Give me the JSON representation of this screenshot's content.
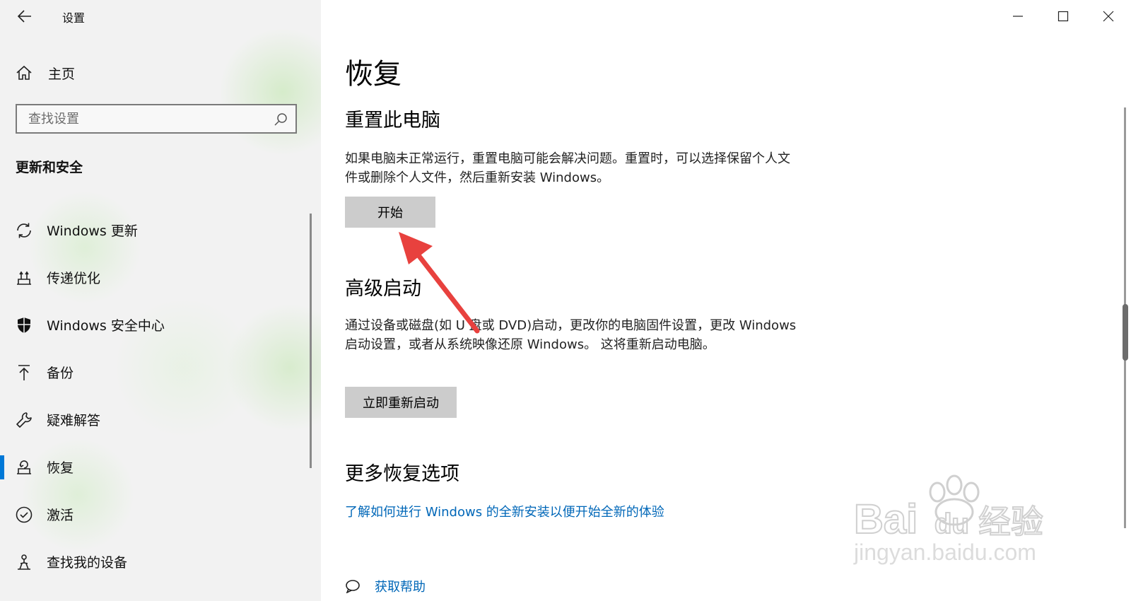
{
  "window": {
    "title": "设置"
  },
  "sidebar": {
    "home_label": "主页",
    "search_placeholder": "查找设置",
    "section_title": "更新和安全",
    "items": [
      {
        "label": "Windows 更新",
        "icon": "sync-icon"
      },
      {
        "label": "传递优化",
        "icon": "delivery-optimization-icon"
      },
      {
        "label": "Windows 安全中心",
        "icon": "shield-icon"
      },
      {
        "label": "备份",
        "icon": "upload-arrow-icon"
      },
      {
        "label": "疑难解答",
        "icon": "wrench-icon"
      },
      {
        "label": "恢复",
        "icon": "recovery-icon",
        "active": true
      },
      {
        "label": "激活",
        "icon": "check-circle-icon"
      },
      {
        "label": "查找我的设备",
        "icon": "find-device-icon"
      }
    ]
  },
  "main": {
    "title": "恢复",
    "reset": {
      "heading": "重置此电脑",
      "description": "如果电脑未正常运行，重置电脑可能会解决问题。重置时，可以选择保留个人文件或删除个人文件，然后重新安装 Windows。",
      "button": "开始"
    },
    "advanced": {
      "heading": "高级启动",
      "description": "通过设备或磁盘(如 U 盘或 DVD)启动，更改你的电脑固件设置，更改 Windows 启动设置，或者从系统映像还原 Windows。 这将重新启动电脑。",
      "button": "立即重新启动"
    },
    "more": {
      "heading": "更多恢复选项",
      "link": "了解如何进行 Windows 的全新安装以便开始全新的体验"
    },
    "help": {
      "label": "获取帮助"
    }
  },
  "watermark": {
    "line1": "Baidu经验",
    "line2": "jingyan.baidu.com"
  },
  "colors": {
    "accent": "#0078d7",
    "link": "#0067b8",
    "button": "#cccccc",
    "annotation_arrow": "#e8413e"
  }
}
